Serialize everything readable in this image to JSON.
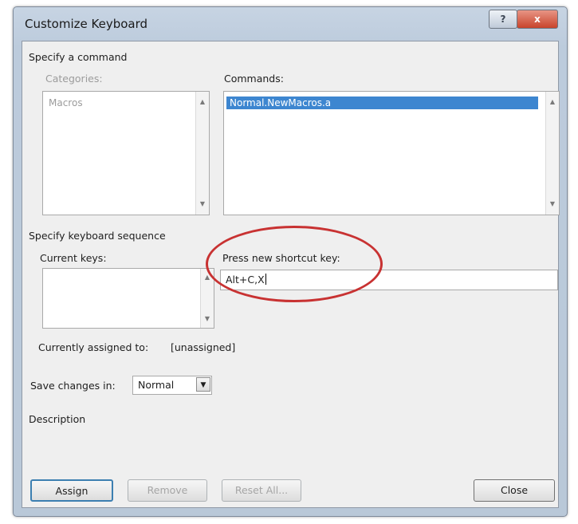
{
  "window": {
    "title": "Customize Keyboard",
    "help_label": "?",
    "close_label": "x"
  },
  "specify_command": {
    "group_label": "Specify a command",
    "categories_label": "Categories:",
    "categories": [
      "Macros"
    ],
    "commands_label": "Commands:",
    "commands": [
      "Normal.NewMacros.a"
    ],
    "selected_command": "Normal.NewMacros.a"
  },
  "keyboard_sequence": {
    "group_label": "Specify keyboard sequence",
    "current_keys_label": "Current keys:",
    "current_keys": [],
    "new_shortcut_label": "Press new shortcut key:",
    "new_shortcut_value": "Alt+C,X"
  },
  "assignment": {
    "label": "Currently assigned to:",
    "value": "[unassigned]"
  },
  "save_changes": {
    "label": "Save changes in:",
    "value": "Normal"
  },
  "description": {
    "label": "Description",
    "text": ""
  },
  "buttons": {
    "assign": "Assign",
    "remove": "Remove",
    "reset_all": "Reset All...",
    "close": "Close"
  },
  "colors": {
    "selection": "#3d86d0",
    "annotation_circle": "#c83232",
    "default_button_border": "#3c7fb1"
  }
}
